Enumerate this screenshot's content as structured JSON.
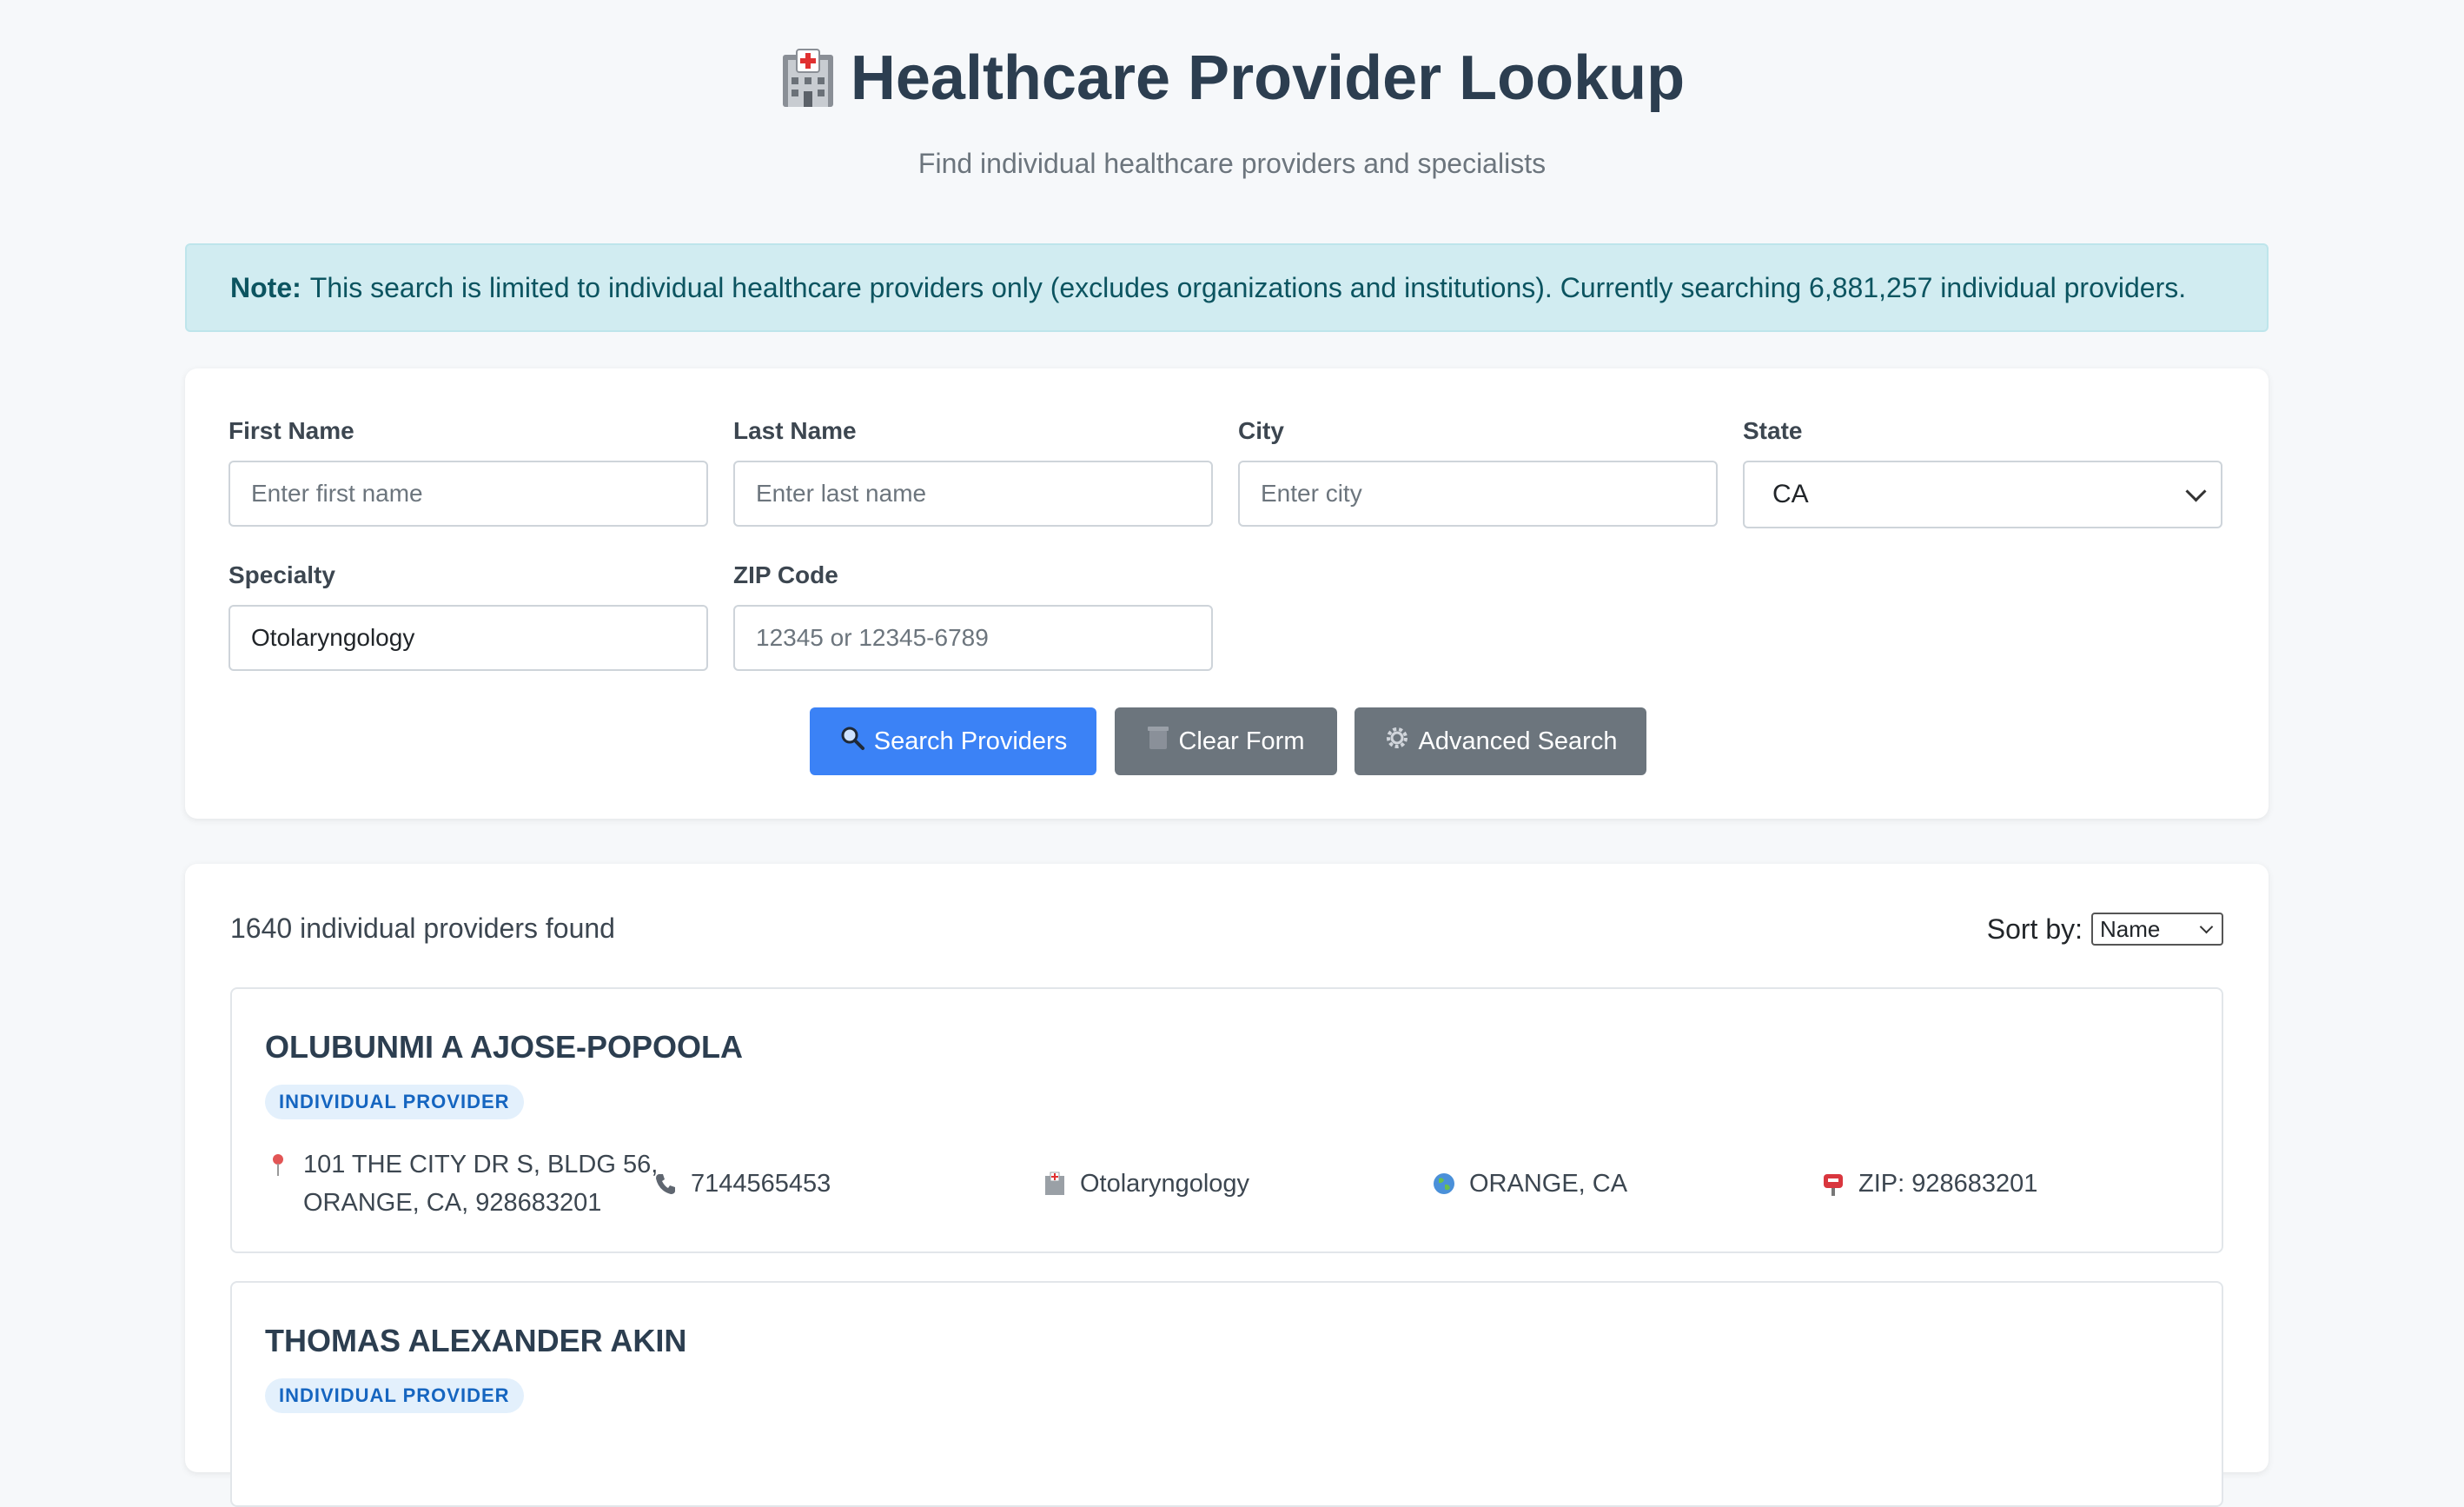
{
  "header": {
    "title": "Healthcare Provider Lookup",
    "subtitle": "Find individual healthcare providers and specialists"
  },
  "note": {
    "label": "Note:",
    "text": "This search is limited to individual healthcare providers only (excludes organizations and institutions). Currently searching 6,881,257 individual providers."
  },
  "form": {
    "first_name": {
      "label": "First Name",
      "placeholder": "Enter first name",
      "value": ""
    },
    "last_name": {
      "label": "Last Name",
      "placeholder": "Enter last name",
      "value": ""
    },
    "city": {
      "label": "City",
      "placeholder": "Enter city",
      "value": ""
    },
    "state": {
      "label": "State",
      "value": "CA"
    },
    "specialty": {
      "label": "Specialty",
      "placeholder": "",
      "value": "Otolaryngology"
    },
    "zip": {
      "label": "ZIP Code",
      "placeholder": "12345 or 12345-6789",
      "value": ""
    },
    "buttons": {
      "search": "Search Providers",
      "clear": "Clear Form",
      "advanced": "Advanced Search"
    }
  },
  "results": {
    "count_text": "1640 individual providers found",
    "sort_label": "Sort by:",
    "sort_value": "Name",
    "providers": [
      {
        "name": "OLUBUNMI A AJOSE-POPOOLA",
        "badge": "INDIVIDUAL PROVIDER",
        "address_line1": "101 THE CITY DR S, BLDG 56,",
        "address_line2": "ORANGE, CA, 928683201",
        "phone": "7144565453",
        "specialty": "Otolaryngology",
        "location": "ORANGE, CA",
        "zip": "ZIP: 928683201"
      },
      {
        "name": "THOMAS ALEXANDER AKIN",
        "badge": "INDIVIDUAL PROVIDER"
      }
    ]
  },
  "colors": {
    "primary": "#3b82f6",
    "secondary": "#6c757d",
    "note_bg": "#d1ecf1",
    "badge_bg": "#e3f0fc",
    "badge_text": "#1565c0"
  }
}
